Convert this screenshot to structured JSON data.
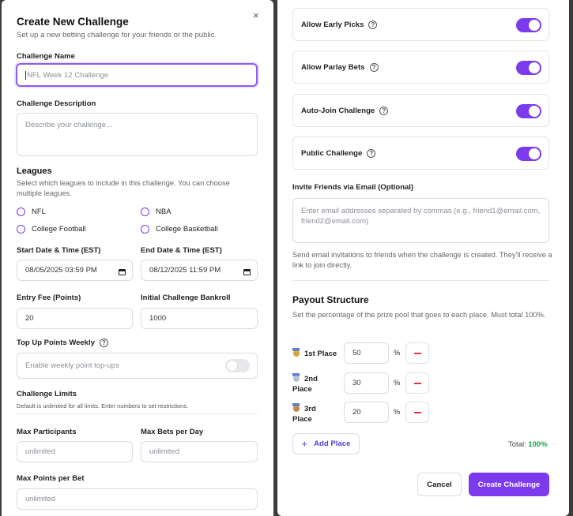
{
  "create_modal": {
    "title": "Create New Challenge",
    "subtitle": "Set up a new betting challenge for your friends or the public.",
    "close_symbol": "×",
    "challenge_name": {
      "label": "Challenge Name",
      "placeholder": "NFL Week 12 Challenge"
    },
    "challenge_description": {
      "label": "Challenge Description",
      "placeholder": "Describe your challenge..."
    },
    "leagues": {
      "title": "Leagues",
      "help": "Select which leagues to include in this challenge. You can choose multiple leagues.",
      "options": [
        "NFL",
        "NBA",
        "College Football",
        "College Basketball"
      ]
    },
    "start_date": {
      "label": "Start Date & Time (EST)",
      "value": "08/05/2025 03:59 PM"
    },
    "end_date": {
      "label": "End Date & Time (EST)",
      "value": "08/12/2025 11:59 PM"
    },
    "entry_fee": {
      "label": "Entry Fee (Points)",
      "value": "20"
    },
    "bankroll": {
      "label": "Initial Challenge Bankroll",
      "value": "1000"
    },
    "top_up": {
      "label": "Top Up Points Weekly",
      "toggle_text": "Enable weekly point top-ups",
      "enabled": false
    },
    "limits": {
      "title": "Challenge Limits",
      "help": "Default is unlimited for all limits. Enter numbers to set restrictions.",
      "max_participants": {
        "label": "Max Participants",
        "placeholder": "unlimited"
      },
      "max_bets_per_day": {
        "label": "Max Bets per Day",
        "placeholder": "unlimited"
      },
      "max_points_per_bet": {
        "label": "Max Points per Bet",
        "placeholder": "unlimited"
      }
    }
  },
  "settings_panel": {
    "toggles": [
      {
        "label": "Allow Early Picks",
        "enabled": true
      },
      {
        "label": "Allow Parlay Bets",
        "enabled": true
      },
      {
        "label": "Auto-Join Challenge",
        "enabled": true
      },
      {
        "label": "Public Challenge",
        "enabled": true
      }
    ],
    "help_icon_glyph": "?",
    "invite": {
      "label": "Invite Friends via Email (Optional)",
      "placeholder": "Enter email addresses separated by commas (e.g., friend1@email.com, friend2@email.com)",
      "help": "Send email invitations to friends when the challenge is created. They'll receive a link to join directly."
    },
    "payout": {
      "title": "Payout Structure",
      "help": "Set the percentage of the prize pool that goes to each place. Must total 100%.",
      "percent_symbol": "%",
      "places": [
        {
          "label": "1st Place",
          "value": "50",
          "medal_color": "#d8a23c"
        },
        {
          "label": "2nd Place",
          "value": "30",
          "medal_color": "#b9c0cc"
        },
        {
          "label": "3rd Place",
          "value": "20",
          "medal_color": "#c7864a"
        }
      ],
      "add_place_label": "Add Place",
      "add_symbol": "+",
      "total_label": "Total:",
      "total_value": "100%"
    },
    "cancel_label": "Cancel",
    "create_label": "Create Challenge"
  },
  "colors": {
    "accent": "#7c3aed",
    "success": "#16a34a",
    "danger": "#e0334a"
  }
}
